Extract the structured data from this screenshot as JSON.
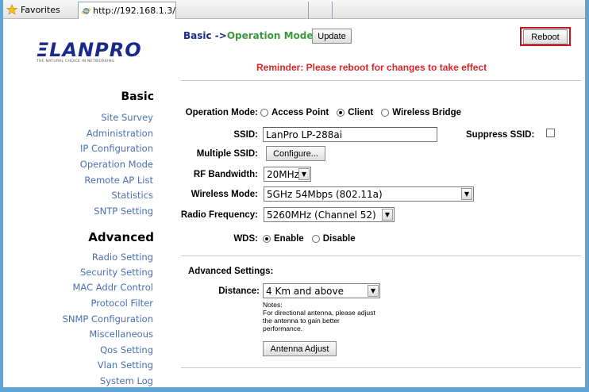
{
  "browser": {
    "favorites_label": "Favorites",
    "tab_url": "http://192.168.1.3/"
  },
  "sidebar": {
    "logo_text": "ΞLANPRO",
    "logo_sub": "THE NATURAL CHOICE IN NETWORKING",
    "basic_heading": "Basic",
    "basic_items": [
      "Site Survey",
      "Administration",
      "IP Configuration",
      "Operation Mode",
      "Remote AP List",
      "Statistics",
      "SNTP Setting"
    ],
    "advanced_heading": "Advanced",
    "advanced_items": [
      "Radio Setting",
      "Security Setting",
      "MAC Addr Control",
      "Protocol Filter",
      "SNMP Configuration",
      "Miscellaneous",
      "Qos Setting",
      "Vlan Setting",
      "System Log"
    ]
  },
  "header": {
    "crumb_part1": "Basic ->",
    "crumb_part2": "Operation Mode",
    "update_label": "Update",
    "reboot_label": "Reboot",
    "reminder": "Reminder: Please reboot for changes to take effect"
  },
  "form": {
    "operation_mode_label": "Operation Mode:",
    "mode_options": [
      "Access Point",
      "Client",
      "Wireless Bridge"
    ],
    "mode_selected": "Client",
    "ssid_label": "SSID:",
    "ssid_value": "LanPro LP-288ai",
    "suppress_label": "Suppress SSID:",
    "multiple_ssid_label": "Multiple SSID:",
    "configure_label": "Configure...",
    "rf_bandwidth_label": "RF Bandwidth:",
    "rf_bandwidth_value": "20MHz",
    "wireless_mode_label": "Wireless Mode:",
    "wireless_mode_value": "5GHz 54Mbps (802.11a)",
    "radio_freq_label": "Radio Frequency:",
    "radio_freq_value": "5260MHz (Channel 52)",
    "wds_label": "WDS:",
    "wds_options": [
      "Enable",
      "Disable"
    ],
    "wds_selected": "Enable"
  },
  "advanced": {
    "heading": "Advanced Settings:",
    "distance_label": "Distance:",
    "distance_value": "4 Km and above",
    "notes_lines": [
      "Notes:",
      "For directional antenna, please adjust",
      "the antenna to gain better",
      "performance."
    ],
    "antenna_adjust_label": "Antenna Adjust"
  }
}
